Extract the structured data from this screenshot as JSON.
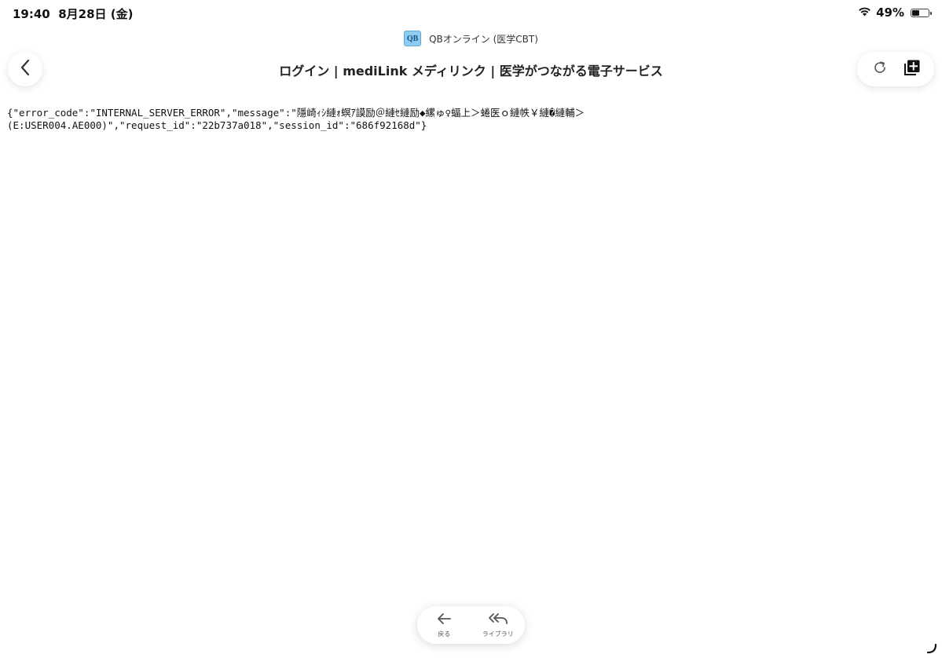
{
  "status_bar": {
    "time": "19:40",
    "date": "8月28日 (金)",
    "battery_percent": "49%",
    "battery_level": 0.49
  },
  "site": {
    "favicon_text": "QB",
    "name": "QBオンライン (医学CBT)"
  },
  "page": {
    "title": "ログイン | mediLink メディリンク | 医学がつながる電子サービス",
    "body_text": "{\"error_code\":\"INTERNAL_SERVER_ERROR\",\"message\":\"隱崎ｨｼ縺ｫ螟ｱ謨励＠縺ｾ縺励◆縲ゅ♀蝠上＞蜷医ｏ縺帙￥縺�縺輔＞\n(E:USER004.AE000)\",\"request_id\":\"22b737a018\",\"session_id\":\"686f92168d\"}"
  },
  "toolbar": {
    "back_label": "戻る",
    "library_label": "ライブラリ"
  },
  "icons": {
    "nav_back": "chevron-left-icon",
    "reload": "reload-icon",
    "add": "add-to-collection-icon",
    "wifi": "wifi-icon",
    "battery": "battery-icon"
  }
}
